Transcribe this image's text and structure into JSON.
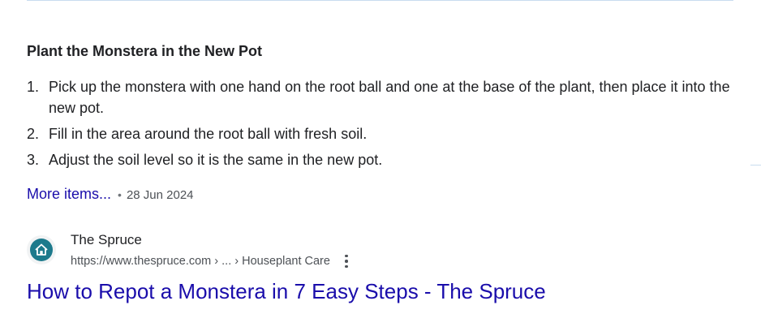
{
  "snippet": {
    "heading": "Plant the Monstera in the New Pot",
    "steps": [
      {
        "num": "1.",
        "text": "Pick up the monstera with one hand on the root ball and one at the base of the plant, then place it into the new pot."
      },
      {
        "num": "2.",
        "text": "Fill in the area around the root ball with fresh soil."
      },
      {
        "num": "3.",
        "text": "Adjust the soil level so it is the same in the new pot."
      }
    ],
    "more_items": "More items...",
    "separator": "•",
    "date": "28 Jun 2024"
  },
  "result": {
    "site_name": "The Spruce",
    "url": "https://www.thespruce.com › ... › Houseplant Care",
    "title": "How to Repot a Monstera in 7 Easy Steps - The Spruce",
    "favicon_icon": "house-icon",
    "menu_icon": "more-vert-icon"
  },
  "colors": {
    "link": "#1a0dab",
    "favicon_bg": "#1d7a8c",
    "text": "#202124",
    "muted": "#4d5156"
  }
}
